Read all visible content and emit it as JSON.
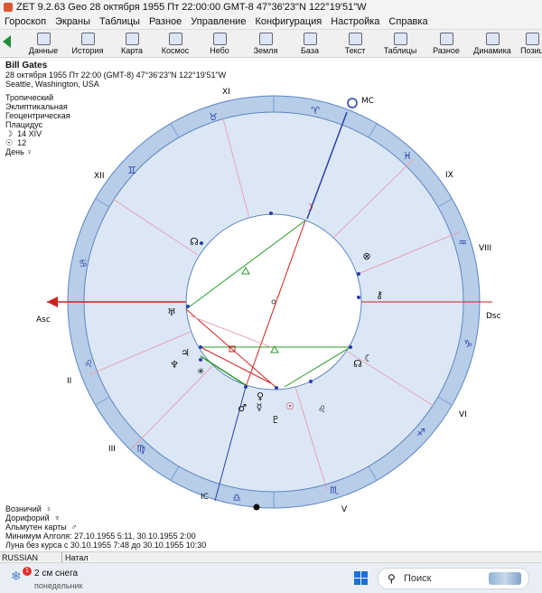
{
  "window": {
    "title": "ZET 9.2.63 Geo   28 октября 1955  Пт  22:00:00 GMT-8 47°36'23\"N  122°19'51\"W"
  },
  "menu": [
    "Гороскоп",
    "Экраны",
    "Таблицы",
    "Разное",
    "Управление",
    "Конфигурация",
    "Настройка",
    "Справка"
  ],
  "toolbar": [
    "Данные",
    "История",
    "Карта",
    "Космос",
    "Небо",
    "Земля",
    "База",
    "Текст",
    "Таблицы",
    "Разное",
    "Динамика",
    "Позиц"
  ],
  "chart_info": {
    "name": "Bill Gates",
    "date_line": "28 октября 1955  Пт  22:00 (GMT-8) 47°36'23\"N  122°19'51\"W",
    "place": "Seattle, Washington, USA",
    "zodiac": "Тропический",
    "coords": "Эклиптикальная",
    "center": "Геоцентрическая",
    "houses": "Плацидус",
    "moon_day_glyph": "☽",
    "moon_day": "14 XIV",
    "sun_glyph": "☉",
    "sun_value": "12",
    "day_label": "День",
    "day_glyph": "♀"
  },
  "bottom_info": {
    "line1_label": "Возничий",
    "line1_glyph": "♀",
    "line2_label": "Дорифорий",
    "line2_glyph": "♆",
    "line3_label": "Альмутен карты",
    "line3_glyph": "♂",
    "line4": "Минимум Алголя: 27.10.1955  5:11,  30.10.1955  2:00",
    "line5": "Луна без курса с 30.10.1955  7:48 до 30.10.1955 10:30"
  },
  "wheel": {
    "angles": {
      "asc": "Asc",
      "dsc": "Dsc",
      "mc": "MC",
      "ic": "IC"
    },
    "houses": [
      "XI",
      "XII",
      "II",
      "III",
      "V",
      "VI",
      "VIII",
      "IX"
    ],
    "signs": [
      "♉",
      "♈",
      "♓",
      "♒",
      "♊",
      "♋",
      "♌",
      "♍",
      "♎",
      "♏",
      "♐",
      "♑"
    ],
    "planets": [
      "☽",
      "☊",
      "⊗",
      "⚷",
      "♅",
      "♃",
      "♆",
      "♀",
      "♂",
      "☿",
      "♇",
      "☉",
      "☊",
      "☾"
    ]
  },
  "status": {
    "language": "RUSSIAN",
    "mode": "Натал"
  },
  "taskbar": {
    "weather_badge": "1",
    "weather_text": "2 см снега",
    "weather_sub": "понедельник",
    "search_placeholder": "Поиск"
  }
}
